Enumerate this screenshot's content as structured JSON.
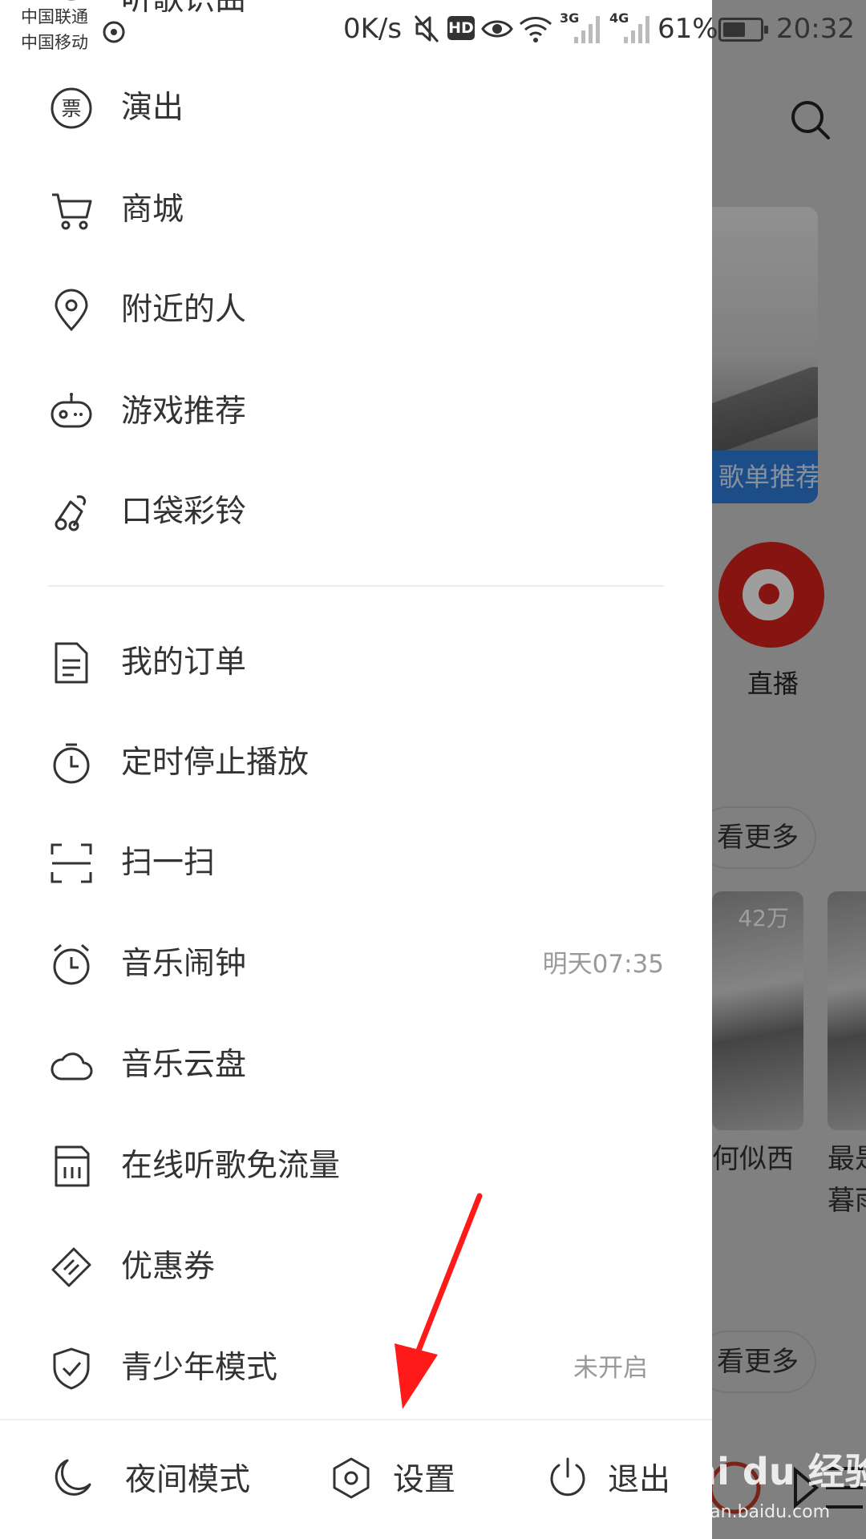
{
  "status_bar": {
    "carrier_1": "中国联通",
    "carrier_2": "中国移动",
    "speed": "0K/s",
    "hd_badge": "HD",
    "signal_1": "3G",
    "signal_2": "4G",
    "battery_percent": "61%",
    "battery_level": 0.61,
    "time": "20:32",
    "icons": [
      "mute-icon",
      "hd-icon",
      "eye-icon",
      "wifi-icon",
      "signal-3g-icon",
      "signal-4g-icon",
      "battery-icon"
    ]
  },
  "drawer": {
    "partial_item": {
      "label": "听歌识曲",
      "icon": "music-recognize-icon"
    },
    "group_1": [
      {
        "label": "演出",
        "icon": "ticket-icon"
      },
      {
        "label": "商城",
        "icon": "cart-icon"
      },
      {
        "label": "附近的人",
        "icon": "location-pin-icon"
      },
      {
        "label": "游戏推荐",
        "icon": "gamepad-icon"
      },
      {
        "label": "口袋彩铃",
        "icon": "ringtone-icon"
      }
    ],
    "group_2": [
      {
        "label": "我的订单",
        "icon": "order-document-icon",
        "value": ""
      },
      {
        "label": "定时停止播放",
        "icon": "timer-icon",
        "value": ""
      },
      {
        "label": "扫一扫",
        "icon": "scan-icon",
        "value": ""
      },
      {
        "label": "音乐闹钟",
        "icon": "alarm-clock-icon",
        "value": "明天07:35"
      },
      {
        "label": "音乐云盘",
        "icon": "cloud-icon",
        "value": ""
      },
      {
        "label": "在线听歌免流量",
        "icon": "sim-card-icon",
        "value": ""
      },
      {
        "label": "优惠券",
        "icon": "coupon-icon",
        "value": ""
      },
      {
        "label": "青少年模式",
        "icon": "shield-check-icon",
        "value": "未开启"
      }
    ],
    "bottom_bar": [
      {
        "label": "夜间模式",
        "icon": "moon-icon"
      },
      {
        "label": "设置",
        "icon": "settings-hexagon-icon"
      },
      {
        "label": "退出",
        "icon": "power-icon"
      }
    ]
  },
  "background_app": {
    "banner_tag": "歌单推荐",
    "live_label": "直播",
    "more_label_1": "看更多",
    "more_label_2": "看更多",
    "card_1_count": "42万",
    "card_1_title": "何似西",
    "card_2_title_line_1": "最是",
    "card_2_title_line_2": "暮雨"
  },
  "watermark": {
    "logo": "Bai du 经验",
    "url": "jingyan.baidu.com"
  },
  "colors": {
    "accent_red": "#d9221c",
    "arrow_red": "#ff1a1a",
    "banner_blue": "#2f7dd8",
    "text_primary": "#333333",
    "text_secondary": "#999999"
  }
}
